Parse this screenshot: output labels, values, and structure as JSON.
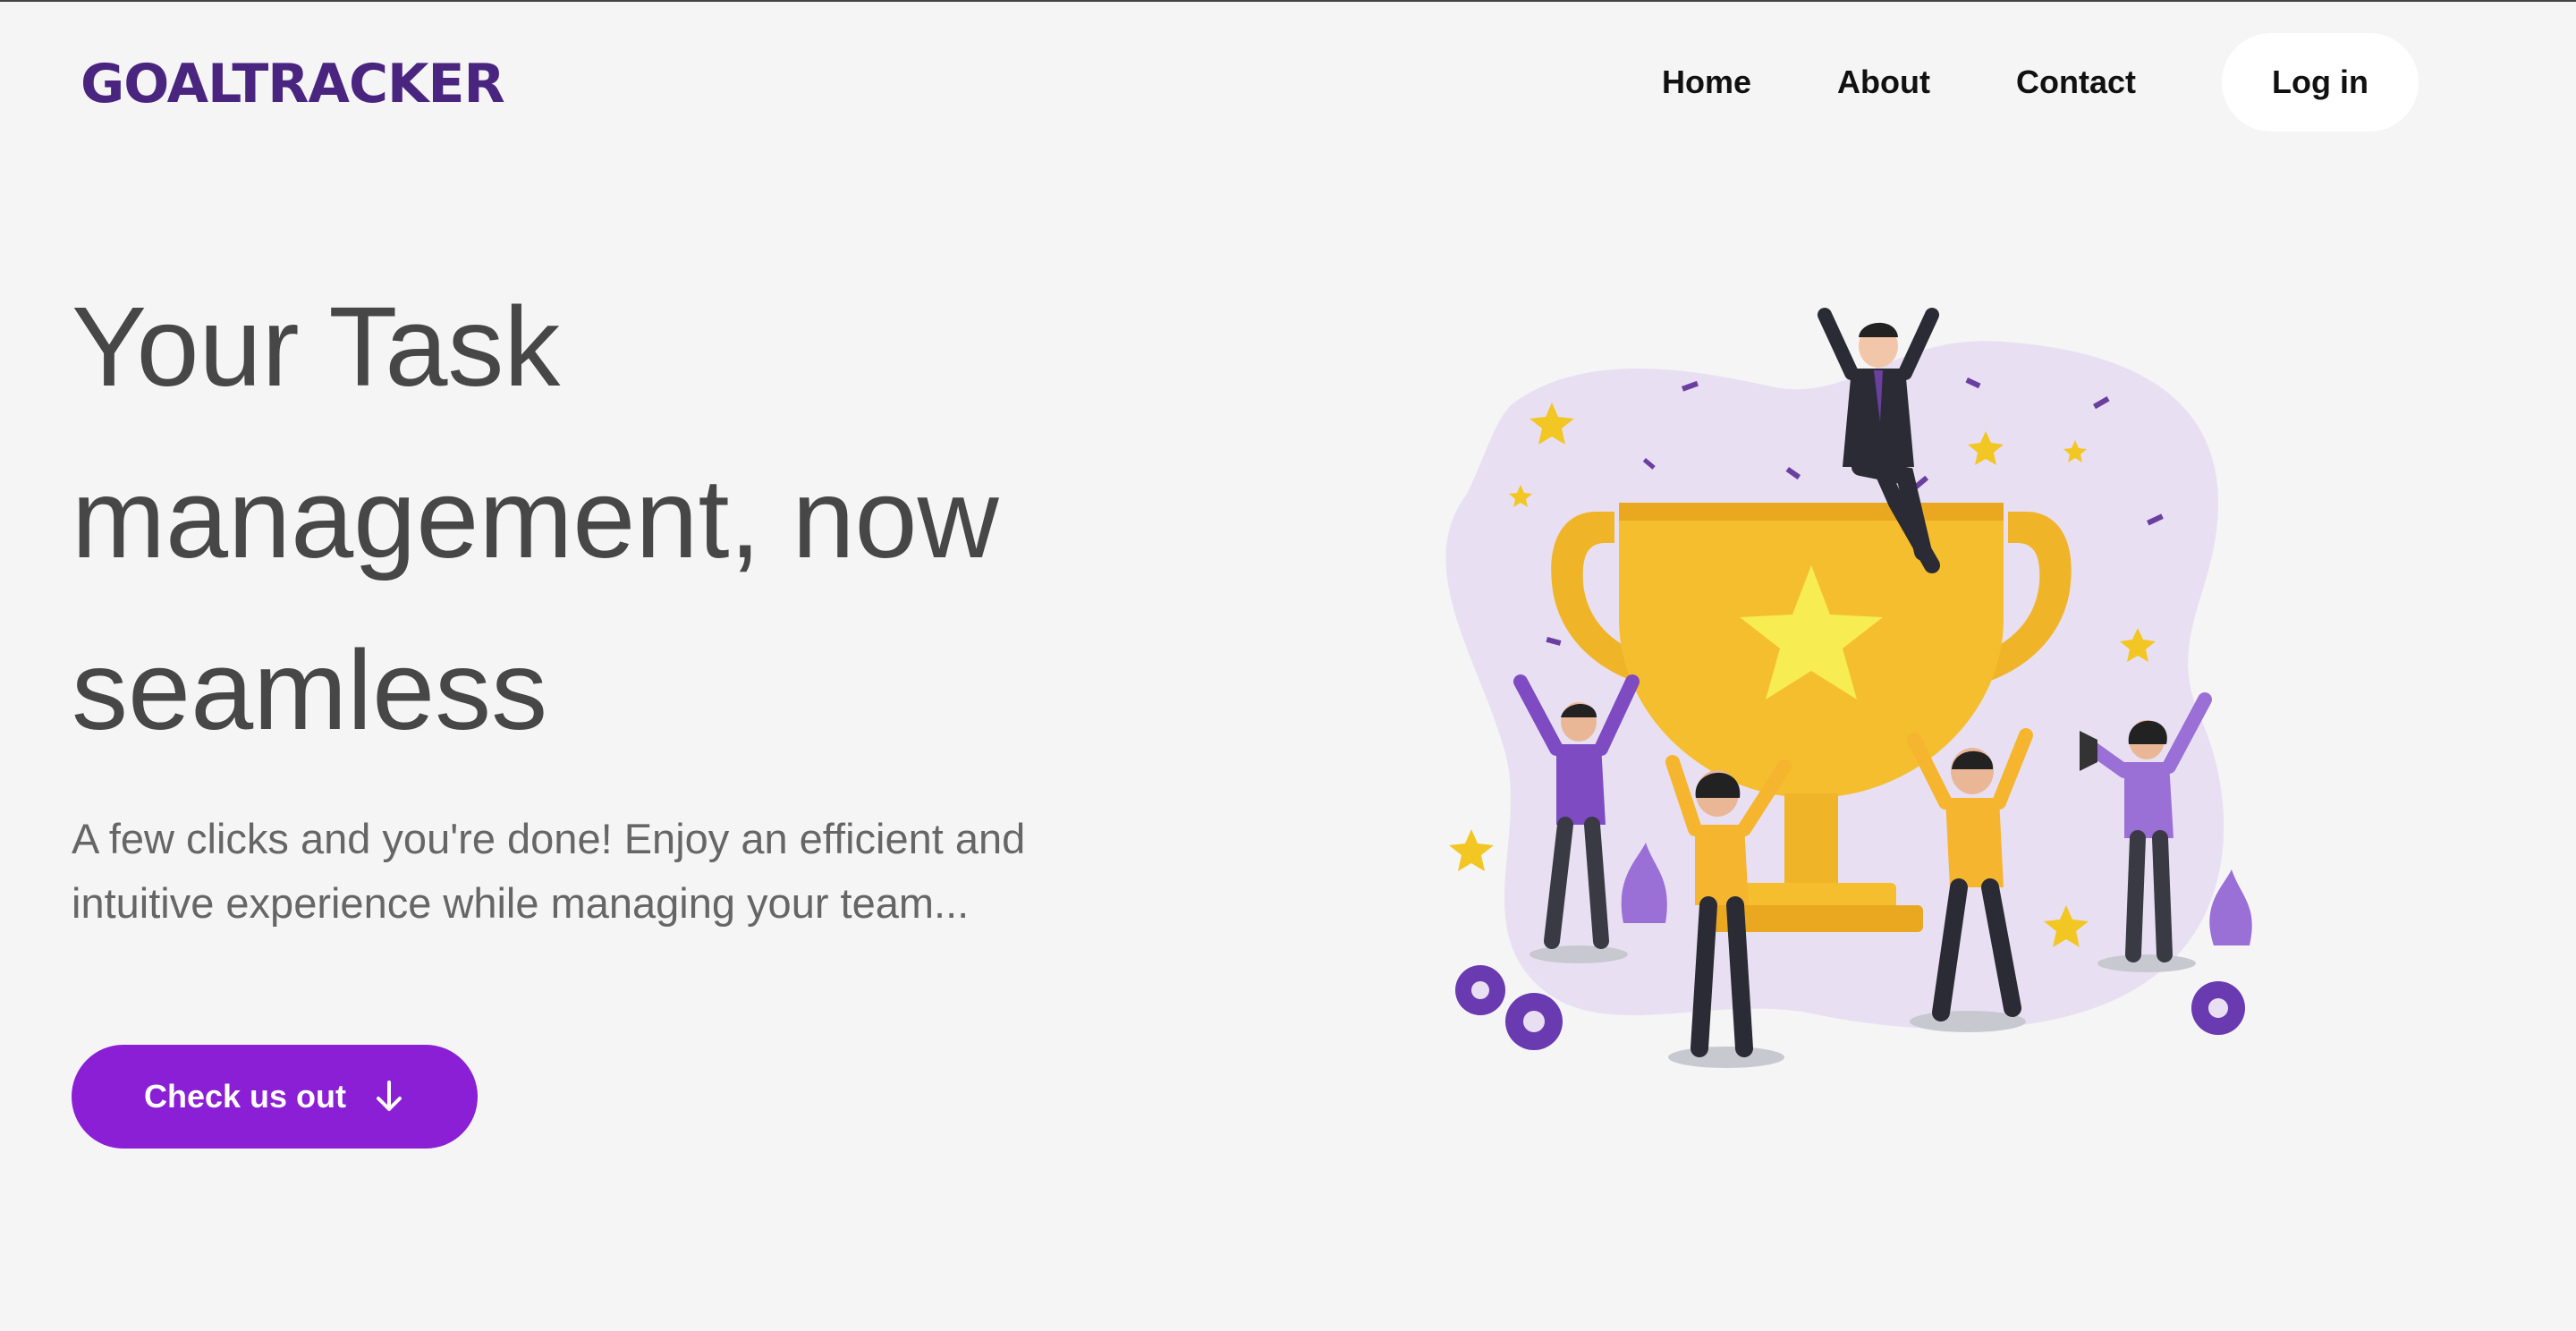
{
  "header": {
    "logo": "GOALTRACKER",
    "nav": [
      "Home",
      "About",
      "Contact"
    ],
    "login_label": "Log in"
  },
  "hero": {
    "title": "Your Task management, now seamless",
    "subtitle": "A few clicks and you're done! Enjoy an efficient and intuitive experience while managing your team...",
    "cta_label": "Check us out",
    "cta_icon": "arrow-down-icon"
  },
  "colors": {
    "brand": "#4a2580",
    "accent": "#8a1fd6",
    "background": "#f5f5f5"
  }
}
